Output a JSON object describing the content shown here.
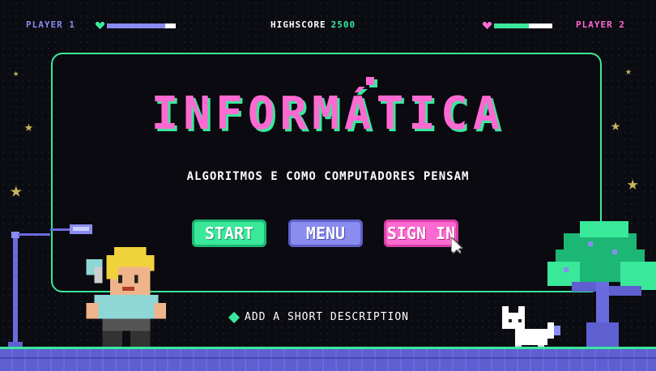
{
  "hud": {
    "player1_label": "PLAYER 1",
    "player1_health": 0.85,
    "highscore_label": "HIGHSCORE",
    "highscore_value": "2500",
    "player2_label": "PLAYER 2",
    "player2_health": 0.6
  },
  "title": "INFORMÁTICA",
  "subtitle": "ALGORITMOS E COMO COMPUTADORES PENSAM",
  "buttons": {
    "start": "START",
    "menu": "MENU",
    "signin": "SIGN IN"
  },
  "description": "ADD A SHORT DESCRIPTION",
  "colors": {
    "pink": "#ff6ad2",
    "green": "#3ae89a",
    "purple": "#8a8cf0",
    "background": "#0b0b12"
  },
  "icons": [
    "heart-icon",
    "star-icon",
    "pointer-cursor-icon",
    "diamond-icon",
    "street-lamp",
    "hero-character",
    "white-cat",
    "pixel-tree"
  ]
}
